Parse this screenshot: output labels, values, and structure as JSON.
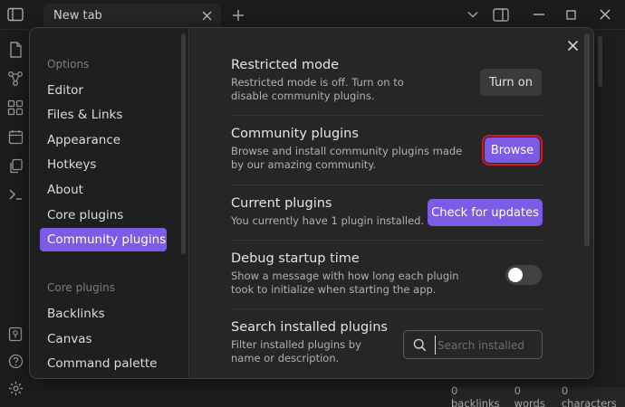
{
  "tabs": [
    {
      "title": "New tab"
    }
  ],
  "settings_sidebar": {
    "options_heading": "Options",
    "options_items": [
      "Editor",
      "Files & Links",
      "Appearance",
      "Hotkeys",
      "About",
      "Core plugins",
      "Community plugins"
    ],
    "active_item": "Community plugins",
    "core_plugins_heading": "Core plugins",
    "core_plugin_items": [
      "Backlinks",
      "Canvas",
      "Command palette"
    ]
  },
  "settings": {
    "restricted_mode": {
      "name": "Restricted mode",
      "description": "Restricted mode is off. Turn on to disable community plugins.",
      "button_label": "Turn on"
    },
    "community_plugins": {
      "name": "Community plugins",
      "description": "Browse and install community plugins made by our amazing community.",
      "button_label": "Browse"
    },
    "current_plugins": {
      "name": "Current plugins",
      "description": "You currently have 1 plugin installed.",
      "button_label": "Check for updates"
    },
    "debug_startup_time": {
      "name": "Debug startup time",
      "description": "Show a message with how long each plugin took to initialize when starting the app.",
      "toggle_on": false
    },
    "search_installed_plugins": {
      "name": "Search installed plugins",
      "description": "Filter installed plugins by name or description.",
      "placeholder": "Search installed",
      "value": ""
    }
  },
  "status_bar": {
    "backlinks": "0 backlinks",
    "words": "0 words",
    "characters": "0 characters"
  },
  "icons": {
    "titlebar": [
      "sidebar-toggle-icon",
      "close-icon",
      "plus-icon",
      "chevron-down-icon",
      "split-view-icon",
      "minimize-icon",
      "maximize-icon",
      "close-icon"
    ],
    "ribbon": [
      "file-explorer-icon",
      "graph-icon",
      "canvas-icon",
      "calendar-icon",
      "copy-icon",
      "terminal-icon",
      "vault-icon",
      "help-icon",
      "settings-icon"
    ]
  },
  "colors": {
    "accent": "#7c5ce6",
    "highlight_outline": "#d8132e",
    "modal_background": "#262626",
    "sidebar_background": "#1f1f1f"
  }
}
